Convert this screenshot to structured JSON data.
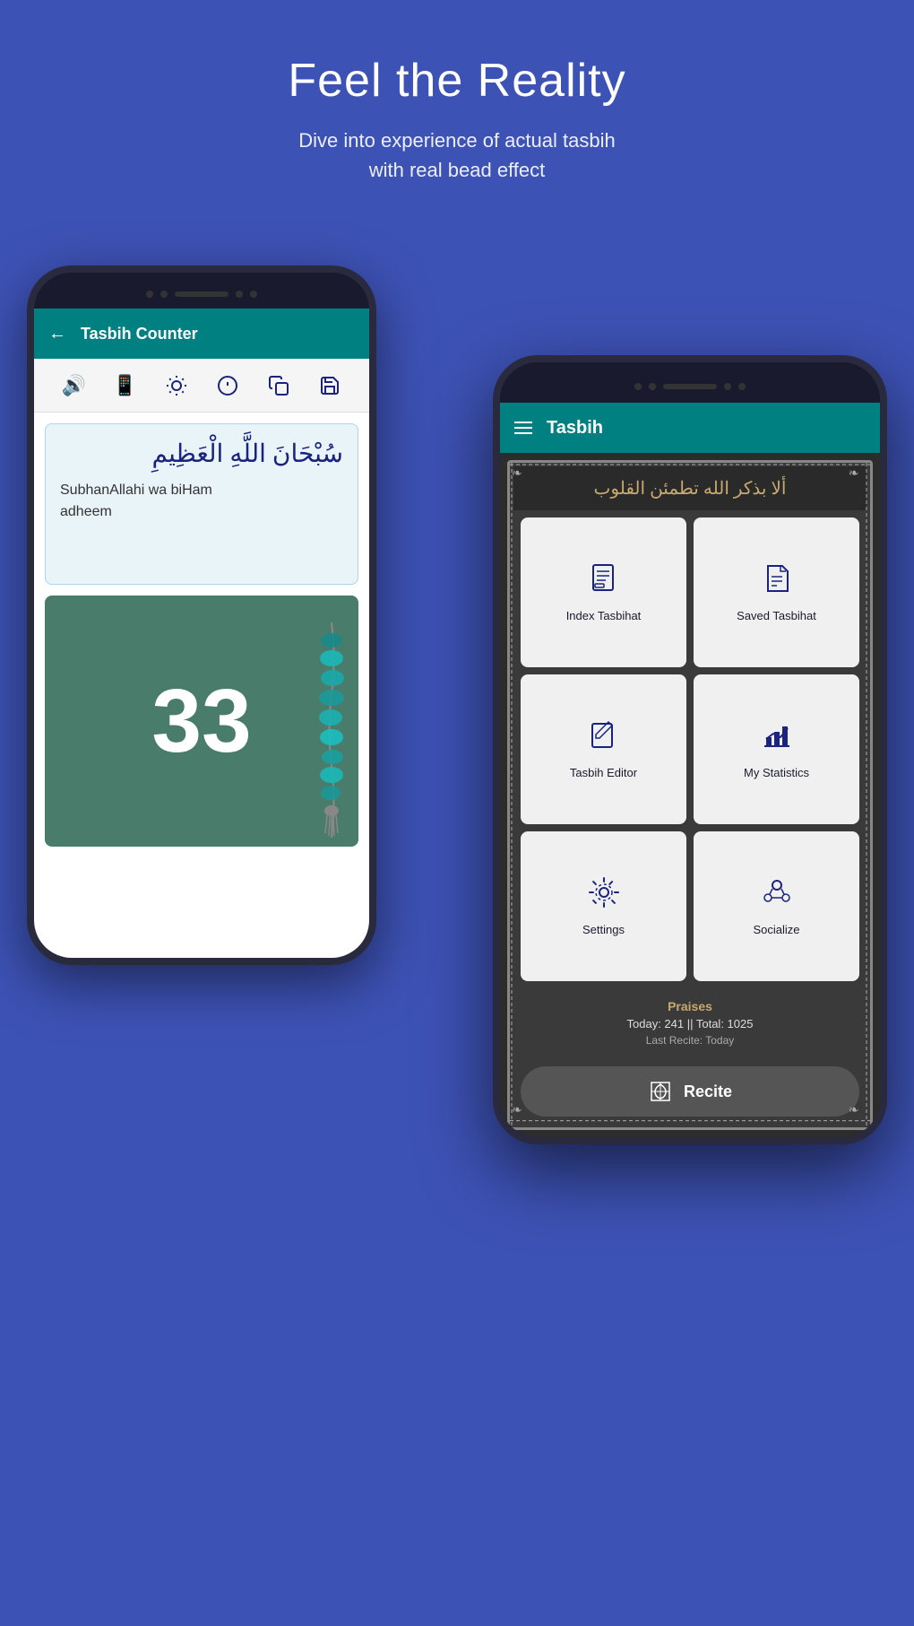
{
  "header": {
    "title": "Feel the Reality",
    "subtitle_line1": "Dive into experience of actual tasbih",
    "subtitle_line2": "with real bead effect"
  },
  "back_phone": {
    "toolbar": {
      "back_label": "←",
      "title": "Tasbih Counter"
    },
    "icons": [
      "🔊",
      "📱",
      "☀",
      "ℹ",
      "⎘",
      "💾"
    ],
    "arabic_text": "سُبْحَانَ اللَّهِ الْعَظِيمِ",
    "transliteration": "SubhanAllahi wa biHam\nadheem",
    "counter": "33"
  },
  "front_phone": {
    "toolbar": {
      "title": "Tasbih"
    },
    "arabic_banner": "ألا بذكر الله تطمئن القلوب",
    "menu_items": [
      {
        "id": "index-tasbihat",
        "label": "Index Tasbihat",
        "icon": "📋"
      },
      {
        "id": "saved-tasbihat",
        "label": "Saved Tasbihat",
        "icon": "💾"
      },
      {
        "id": "tasbih-editor",
        "label": "Tasbih Editor",
        "icon": "✏️"
      },
      {
        "id": "my-statistics",
        "label": "My Statistics",
        "icon": "📊"
      },
      {
        "id": "settings",
        "label": "Settings",
        "icon": "⚙️"
      },
      {
        "id": "socialize",
        "label": "Socialize",
        "icon": "👥"
      }
    ],
    "stats": {
      "label": "Praises",
      "today_value": "Today: 241 || Total: 1025",
      "last_recite": "Last Recite: Today"
    },
    "recite_button": "Recite"
  },
  "colors": {
    "background": "#3d52b5",
    "teal": "#008080",
    "dark_navy": "#1a1a2e",
    "gold": "#c8a96e"
  }
}
